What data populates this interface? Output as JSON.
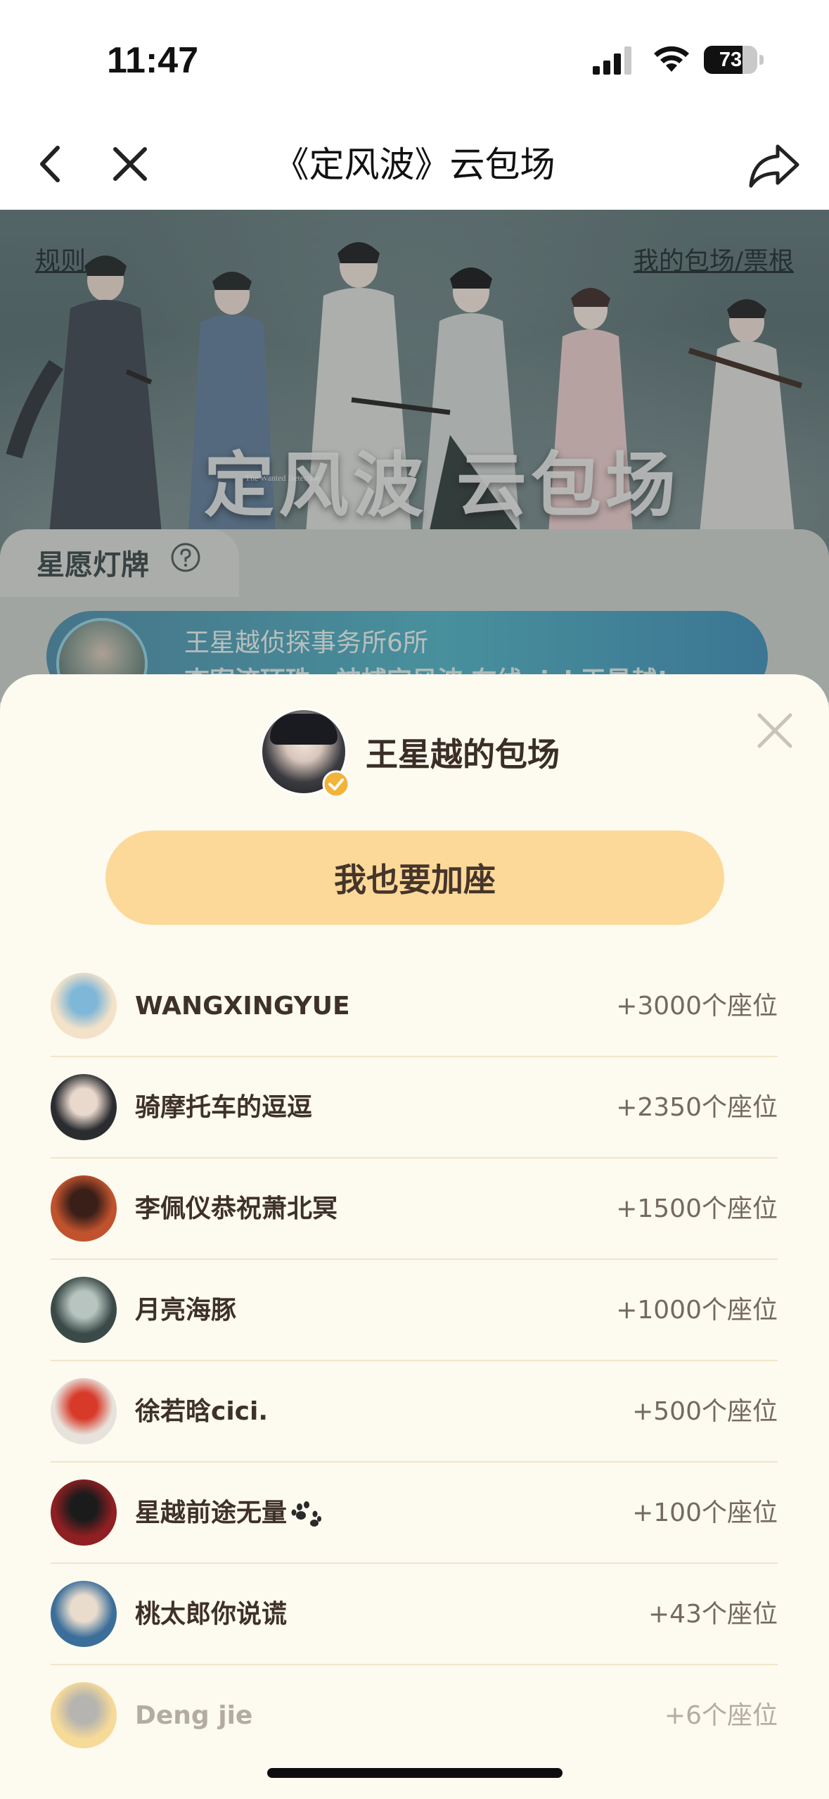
{
  "status_bar": {
    "time": "11:47",
    "battery_level": "73",
    "icons": [
      "signal-icon",
      "wifi-icon",
      "battery-icon"
    ]
  },
  "nav": {
    "title": "《定风波》云包场",
    "icons": [
      "back-icon",
      "close-icon",
      "share-icon"
    ]
  },
  "hero": {
    "rules_link": "规则",
    "my_tickets_link": "我的包场/票根",
    "logo_text": "定风波 云包场",
    "logo_subtext": "The Wanted Detective"
  },
  "star_wish": {
    "title": "星愿灯牌",
    "banner_line1": "王星越侦探事务所6所",
    "banner_line2": "查案流环珠，神捕定风波 在线pick王星越!"
  },
  "sheet": {
    "host_name": "王星越的包场",
    "join_button": "我也要加座",
    "supporters": [
      {
        "name": "WANGXINGYUE",
        "seats": "+3000个座位",
        "avatar_color": "#f3e2c8",
        "avatar_accent": "#7fb7d8"
      },
      {
        "name": "骑摩托车的逗逗",
        "seats": "+2350个座位",
        "avatar_color": "#2a2c30",
        "avatar_accent": "#e9d8cc"
      },
      {
        "name": "李佩仪恭祝萧北冥",
        "seats": "+1500个座位",
        "avatar_color": "#c0532e",
        "avatar_accent": "#3a1e18"
      },
      {
        "name": "月亮海豚",
        "seats": "+1000个座位",
        "avatar_color": "#3a4a48",
        "avatar_accent": "#b7c4bf"
      },
      {
        "name": "徐若晗cici.",
        "seats": "+500个座位",
        "avatar_color": "#e7e3dc",
        "avatar_accent": "#d83a2a"
      },
      {
        "name": "星越前途无量",
        "seats": "+100个座位",
        "avatar_color": "#8e1f22",
        "avatar_accent": "#1b1b1b",
        "has_paw": true
      },
      {
        "name": "桃太郎你说谎",
        "seats": "+43个座位",
        "avatar_color": "#3b6e99",
        "avatar_accent": "#e9dccd"
      },
      {
        "name": "Deng jie",
        "seats": "+6个座位",
        "avatar_color": "#f2c86a",
        "avatar_accent": "#8e8e8e"
      }
    ]
  },
  "colors": {
    "sheet_bg": "#fdfaef",
    "button_bg": "#fcd999",
    "divider": "#f1e5cb"
  }
}
